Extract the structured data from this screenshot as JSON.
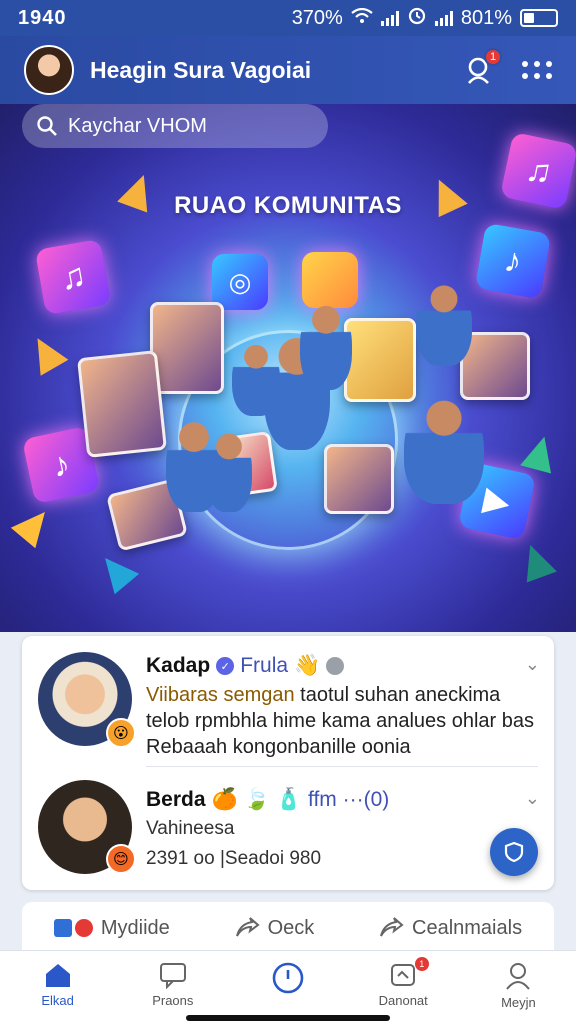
{
  "status_bar": {
    "time": "1940",
    "volume": "370%",
    "battery": "801%"
  },
  "header": {
    "title": "Heagin Sura Vagoiai",
    "notification_count": "1",
    "icons": [
      "avatar",
      "bell-icon",
      "grid-menu-icon"
    ]
  },
  "banner": {
    "search_text": "Kaychar VHOM",
    "title": "RUAO KOMUNITAS"
  },
  "posts": [
    {
      "name": "Kadap",
      "tag": "Frula",
      "text_line1_highlight": "Viibaras semgan",
      "text_line1_rest": "taotul suhan aneckima",
      "text_line2": "telob rpmbhla hime kama analues ohlar bas",
      "text_line3": "Rebaaah kongonbanille oonia",
      "reaction": "😮"
    },
    {
      "name": "Berda",
      "tag": "ffm ···(0)",
      "subtitle": "Vahineesa",
      "meta": "2391 oo |Seadoi 980",
      "reaction": "😊"
    }
  ],
  "action_bar": {
    "items": [
      "Mydiide",
      "Oeck",
      "Cealnmaials"
    ]
  },
  "bottom_nav": {
    "items": [
      {
        "label": "Elkad",
        "icon": "home-icon",
        "active": true
      },
      {
        "label": "Praons",
        "icon": "chat-icon",
        "active": false
      },
      {
        "label": "",
        "icon": "clock-icon",
        "active": false
      },
      {
        "label": "Danonat",
        "icon": "notification-icon",
        "active": false,
        "badge": "1"
      },
      {
        "label": "Meyjn",
        "icon": "profile-icon",
        "active": false
      }
    ]
  },
  "colors": {
    "header": "#2c4fa6",
    "accent": "#2a58c8",
    "badge": "#e53935"
  }
}
